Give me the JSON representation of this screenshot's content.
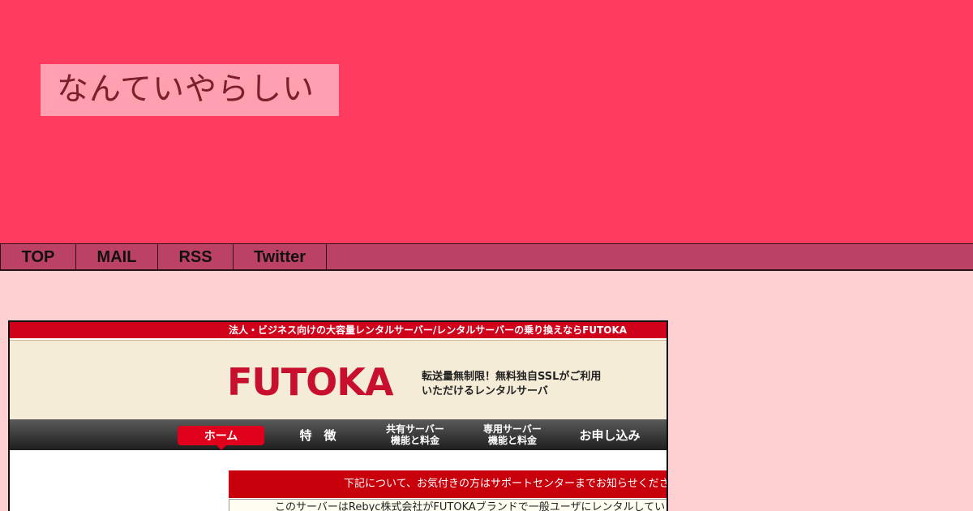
{
  "site": {
    "title": "なんていやらしい"
  },
  "nav": {
    "items": [
      {
        "label": "TOP"
      },
      {
        "label": "MAIL"
      },
      {
        "label": "RSS"
      },
      {
        "label": "Twitter"
      }
    ]
  },
  "embed": {
    "topbar": "法人・ビジネス向けの大容量レンタルサーバー/レンタルサーバーの乗り換えならFUTOKA",
    "logo": "FUTOKA",
    "tagline_line1": "転送量無制限！無料独自SSLがご利用",
    "tagline_line2": "いただけるレンタルサーバ",
    "menu": [
      {
        "label": "ホーム"
      },
      {
        "label": "特　徴"
      },
      {
        "label1": "共有サーバー",
        "label2": "機能と料金"
      },
      {
        "label1": "専用サーバー",
        "label2": "機能と料金"
      },
      {
        "label": "お申し込み"
      }
    ],
    "notice_title": "下記について、お気付きの方はサポートセンターまでお知らせください",
    "notice_body": "このサーバーはRebyc株式会社がFUTOKAブランドで一般ユーザにレンタルしています"
  },
  "colors": {
    "header_bg": "#ff3c5f",
    "nav_bg": "#bb4165",
    "page_bg": "#ffd0d2",
    "brand_red": "#c8102e"
  }
}
